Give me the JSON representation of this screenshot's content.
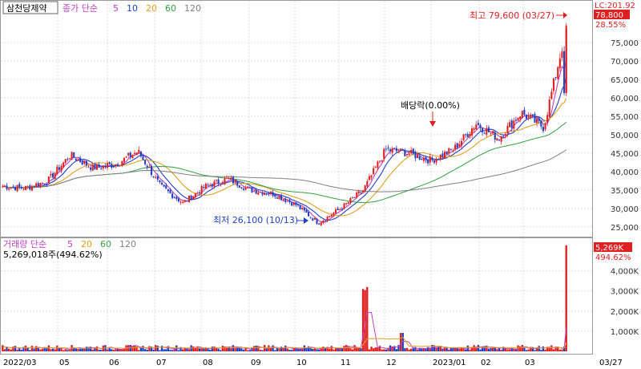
{
  "price_panel": {
    "stock_name": "삼천당제약",
    "legend_prefix": "종가 단순",
    "ma_labels": [
      "5",
      "10",
      "20",
      "60",
      "120"
    ],
    "ma_colors": [
      "#c040c0",
      "#2040c0",
      "#e0a020",
      "#30a040",
      "#808080"
    ],
    "lc_label": "LC:201.92",
    "current_price_label": "78,800",
    "current_pct_label": "28.55%",
    "high_annotation": "최고 79,600 (03/27)",
    "low_annotation": "최저 26,100 (10/13)",
    "dividend_annotation": "배당락(0.00%)",
    "y_ticks": [
      "75,000",
      "70,000",
      "65,000",
      "60,000",
      "55,000",
      "50,000",
      "45,000",
      "40,000",
      "35,000",
      "30,000",
      "25,000"
    ]
  },
  "volume_panel": {
    "legend_prefix": "거래량 단순",
    "ma_labels": [
      "5",
      "20",
      "60",
      "120"
    ],
    "ma_colors": [
      "#c040c0",
      "#e0a020",
      "#30a040",
      "#808080"
    ],
    "volume_text": "5,269,018주(494.62%)",
    "current_volume_label": "5,269K",
    "current_volume_pct": "494.62%",
    "y_ticks": [
      "4,000K",
      "3,000K",
      "2,000K",
      "1,000K"
    ]
  },
  "x_axis": {
    "labels": [
      "2022/03",
      "05",
      "06",
      "07",
      "08",
      "09",
      "10",
      "11",
      "12",
      "2023/01",
      "02",
      "03"
    ],
    "right_label": "03/27"
  },
  "colors": {
    "up": "#e02020",
    "down": "#2040c0",
    "label_bg": "#e02020"
  },
  "chart_data": {
    "type": "candlestick",
    "title": "",
    "ylim": [
      23000,
      80000
    ],
    "volume_ylim": [
      0,
      5500
    ],
    "months": [
      "2022/03",
      "05",
      "06",
      "07",
      "08",
      "09",
      "10",
      "11",
      "12",
      "2023/01",
      "02",
      "03"
    ],
    "price_path": [
      {
        "x": "2022/03",
        "y": 36000
      },
      {
        "x": "2022/04",
        "y": 35500
      },
      {
        "x": "2022/04 mid",
        "y": 37500
      },
      {
        "x": "2022/04 end",
        "y": 44500
      },
      {
        "x": "05",
        "y": 41000
      },
      {
        "x": "05 mid",
        "y": 42000
      },
      {
        "x": "06",
        "y": 45500
      },
      {
        "x": "06 mid",
        "y": 36000
      },
      {
        "x": "07",
        "y": 31500
      },
      {
        "x": "07 end",
        "y": 36000
      },
      {
        "x": "08",
        "y": 38000
      },
      {
        "x": "08 mid",
        "y": 35000
      },
      {
        "x": "09",
        "y": 34000
      },
      {
        "x": "09 end",
        "y": 31000
      },
      {
        "x": "10/13",
        "y": 26100
      },
      {
        "x": "11",
        "y": 30000
      },
      {
        "x": "11 end",
        "y": 35000
      },
      {
        "x": "12",
        "y": 46000
      },
      {
        "x": "12 mid",
        "y": 45000
      },
      {
        "x": "2023/01",
        "y": 43000
      },
      {
        "x": "2023/01 end",
        "y": 46000
      },
      {
        "x": "02",
        "y": 53000
      },
      {
        "x": "02 end",
        "y": 49000
      },
      {
        "x": "03",
        "y": 56000
      },
      {
        "x": "03 mid",
        "y": 52000
      },
      {
        "x": "03/27",
        "y": 78800
      }
    ],
    "series": [
      {
        "name": "5",
        "color": "#c040c0"
      },
      {
        "name": "10",
        "color": "#2040c0"
      },
      {
        "name": "20",
        "color": "#e0a020"
      },
      {
        "name": "60",
        "color": "#30a040"
      },
      {
        "name": "120",
        "color": "#808080"
      }
    ],
    "volume_spikes": [
      {
        "x": "12",
        "value": 3300
      },
      {
        "x": "2023/01",
        "value": 1000
      },
      {
        "x": "03/27",
        "value": 5269
      }
    ],
    "high": {
      "x": "03/27",
      "value": 79600
    },
    "low": {
      "x": "10/13",
      "value": 26100
    },
    "last": {
      "value": 78800,
      "change_pct": 28.55
    }
  }
}
